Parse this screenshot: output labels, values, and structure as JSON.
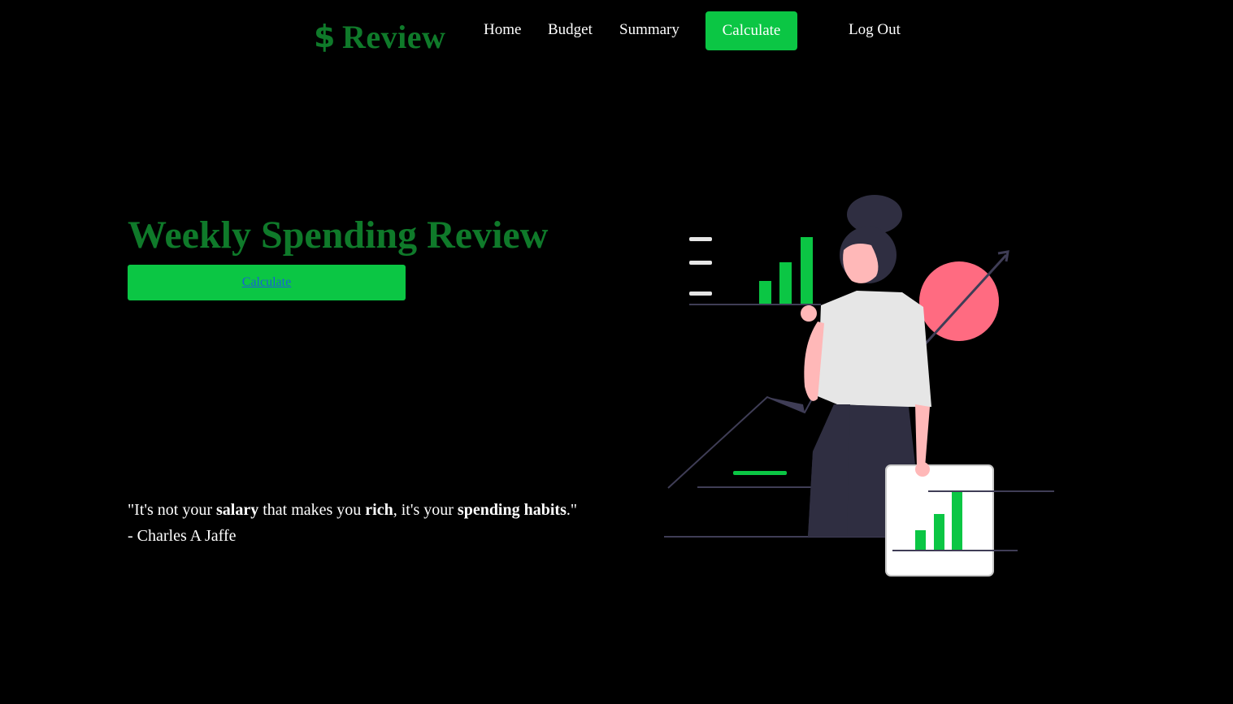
{
  "nav": {
    "logo_symbol": "$",
    "logo_text": "Review",
    "home": "Home",
    "budget": "Budget",
    "summary": "Summary",
    "calculate": "Calculate",
    "logout": "Log Out"
  },
  "hero": {
    "title": "Weekly Spending Review",
    "button_label": "Calculate"
  },
  "quote": {
    "open": "\"It's not your ",
    "w1": "salary",
    "mid1": " that makes you ",
    "w2": "rich",
    "mid2": ", it's your ",
    "w3": "spending habits",
    "close": ".\"",
    "author": "- Charles A Jaffe"
  },
  "colors": {
    "brand_dark_green": "#0f7a2a",
    "accent_green": "#0bc644",
    "background": "#000000",
    "link_blue": "#1a5fd6",
    "illustration_pink": "#ff6b81",
    "illustration_dark": "#2f2e41"
  }
}
